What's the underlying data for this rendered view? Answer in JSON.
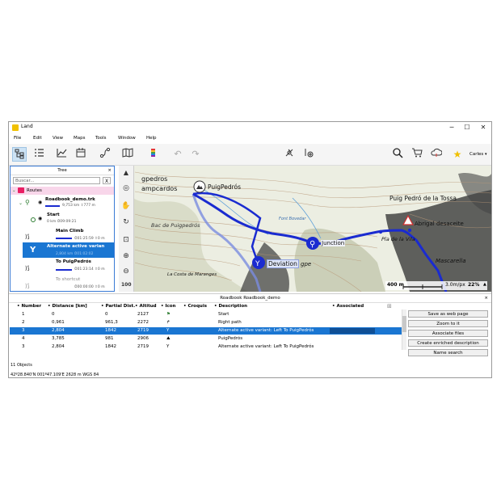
{
  "window": {
    "title": "Land",
    "minimize": "─",
    "maximize": "☐",
    "close": "✕"
  },
  "menu": [
    "File",
    "Edit",
    "View",
    "Maps",
    "Tools",
    "Window",
    "Help"
  ],
  "toolbar": {
    "user": "Carles"
  },
  "tree": {
    "title": "Tree",
    "close": "×",
    "search_placeholder": "Buscar...",
    "search_clear": "X",
    "routes_label": "Routes",
    "track_name": "Roadbook_demo.trk",
    "track_stats": "9,753 km  ⇧777 m",
    "items": [
      {
        "name": "Start",
        "stats": "0 km  ⏱09:09:21"
      },
      {
        "name": "Main Climb",
        "stats": "⏱01:25:59  ⇧0 m"
      },
      {
        "name": "Alternate active varian",
        "stats": "2,804 km  ⏱01:02:02"
      },
      {
        "name": "To PuigPedrós",
        "stats": "⏱01:23:14  ⇧0 m"
      },
      {
        "name": "To shortcut",
        "stats": "⏱00:00:00  ⇧0 m"
      }
    ]
  },
  "map": {
    "labels": [
      "gpedros",
      "ampcardos",
      "PuigPedrós",
      "Puig Pedró de la Tossa",
      "Font Bovedar",
      "Bac de Puigpedrós",
      "Junction",
      "Abrigal desaceite",
      "Pla de la Vila",
      "Deviation",
      "gpe",
      "Mascarella",
      "La Costa de Maranges"
    ],
    "scale_label": "400 m",
    "speed_label": "3.0m/px",
    "zoom_label": "22%",
    "zoom_toolbar_value": "100"
  },
  "roadbook": {
    "title": "Roadbook Roadbook_demo",
    "close": "×",
    "columns": [
      "Number",
      "Distance [km]",
      "Partial Dist.",
      "Altitud",
      "Icon",
      "Croquis",
      "Description",
      "Associated"
    ],
    "rows": [
      {
        "n": "1",
        "dist": "0",
        "partial": "0",
        "alt": "2127",
        "desc": "Start",
        "icon": "flag-icon"
      },
      {
        "n": "2",
        "dist": "0,961",
        "partial": "961,3",
        "alt": "2272",
        "desc": "Right path",
        "icon": "turn-right-icon"
      },
      {
        "n": "3",
        "dist": "2,804",
        "partial": "1842",
        "alt": "2719",
        "desc": "Alternate active variant: Left To PuigPedrós",
        "icon": "fork-icon"
      },
      {
        "n": "4",
        "dist": "3,785",
        "partial": "981",
        "alt": "2906",
        "desc": "PuigPedrós",
        "icon": "summit-icon"
      },
      {
        "n": "3",
        "dist": "2,804",
        "partial": "1842",
        "alt": "2719",
        "desc": "Alternate active variant: Left To PuigPedrós",
        "icon": "fork-icon"
      }
    ],
    "selected_row": 2,
    "actions": [
      "Save as web page",
      "Zoom to it",
      "Associate files",
      "Create enriched description",
      "Name search"
    ],
    "count": "11 Objects"
  },
  "status": {
    "coords": "42º28.840'N 001º47.109'E  2628 m  WGS 84"
  },
  "colors": {
    "route": "#1a2bd0",
    "selection": "#1a76d2",
    "accent": "#f0c000"
  }
}
